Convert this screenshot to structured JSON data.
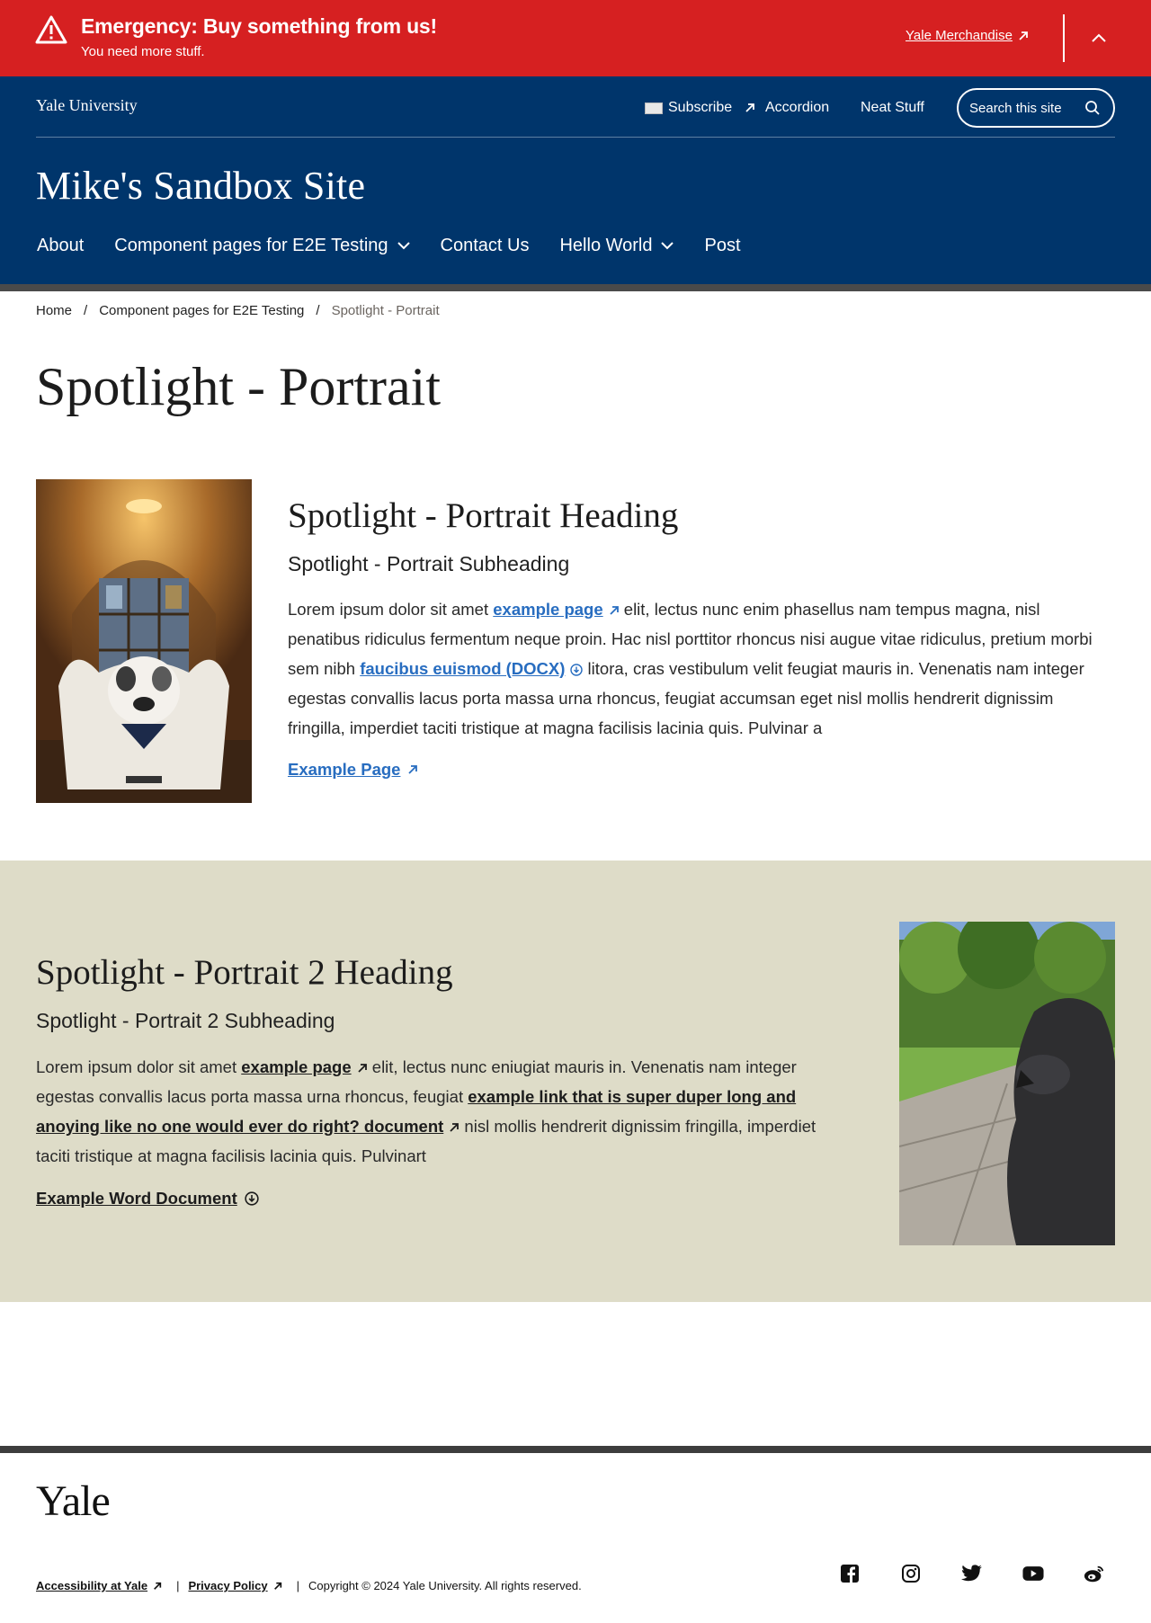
{
  "alert": {
    "title": "Emergency: Buy something from us!",
    "description": "You need more stuff.",
    "link_label": "Yale Merchandise",
    "icon": "warning-icon",
    "collapse_icon": "chevron-up-icon",
    "bg_color": "#d62021"
  },
  "header": {
    "wordmark": "Yale University",
    "utility": {
      "subscribe": "Subscribe",
      "accordion": "Accordion",
      "neat_stuff": "Neat Stuff"
    },
    "search_label": "Search this site",
    "site_title": "Mike's Sandbox Site",
    "bg_color": "#00356b",
    "nav": [
      {
        "label": "About"
      },
      {
        "label": "Component pages for E2E Testing"
      },
      {
        "label": "Contact Us"
      },
      {
        "label": "Hello World"
      },
      {
        "label": "Post"
      }
    ]
  },
  "breadcrumb": {
    "items": [
      "Home",
      "Component pages for E2E Testing"
    ],
    "current": "Spotlight - Portrait",
    "separator": "/"
  },
  "page_title": "Spotlight - Portrait",
  "spotlight1": {
    "heading": "Spotlight - Portrait Heading",
    "subheading": "Spotlight - Portrait Subheading",
    "body_pre": "Lorem ipsum dolor sit amet ",
    "link1": "example page",
    "body_mid1": " elit, lectus nunc enim phasellus nam tempus magna, nisl penatibus ridiculus fermentum neque proin. Hac nisl porttitor rhoncus nisi augue vitae ridiculus, pretium morbi sem nibh ",
    "link2": "faucibus euismod (DOCX)",
    "body_post": " litora, cras vestibulum velit feugiat mauris in. Venenatis nam integer egestas convallis lacus porta massa urna rhoncus, feugiat accumsan eget nisl mollis hendrerit dignissim fringilla, imperdiet taciti tristique at magna facilisis lacinia quis. Pulvinar a",
    "cta": "Example Page",
    "link_color": "#286dc0"
  },
  "spotlight2": {
    "heading": "Spotlight - Portrait 2 Heading",
    "subheading": "Spotlight - Portrait 2 Subheading",
    "body_pre": "Lorem ipsum dolor sit amet ",
    "link1": "example page",
    "body_mid1": " elit, lectus nunc eniugiat mauris in. Venenatis nam integer egestas convallis lacus porta massa urna rhoncus, feugiat ",
    "link2": "example link that is super duper long and anoying like no one would ever do right? document",
    "body_post": " nisl mollis hendrerit dignissim fringilla, imperdiet taciti tristique at magna facilisis lacinia quis. Pulvinart",
    "cta": "Example Word Document",
    "band_color": "#dedcc8"
  },
  "footer": {
    "logo": "Yale",
    "links": [
      "Accessibility at Yale",
      "Privacy Policy"
    ],
    "copyright": "Copyright © 2024 Yale University. All rights reserved.",
    "socials": [
      "facebook-icon",
      "instagram-icon",
      "twitter-icon",
      "youtube-icon",
      "weibo-icon"
    ]
  }
}
